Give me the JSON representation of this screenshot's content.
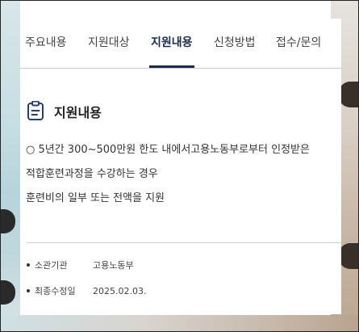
{
  "tabs": [
    {
      "label": "주요내용",
      "active": false
    },
    {
      "label": "지원대상",
      "active": false
    },
    {
      "label": "지원내용",
      "active": true
    },
    {
      "label": "신청방법",
      "active": false
    },
    {
      "label": "접수/문의",
      "active": false
    }
  ],
  "section": {
    "icon": "clipboard-icon",
    "title": "지원내용",
    "lines": [
      "○ 5년간 300~500만원 한도 내에서고용노동부로부터 인정받은",
      "적합훈련과정을 수강하는 경우",
      "훈련비의 일부 또는 전액을 지원"
    ]
  },
  "meta": {
    "agency_label": "소관기관",
    "agency_value": "고용노동부",
    "updated_label": "최종수정일",
    "updated_value": "2025.02.03."
  },
  "colors": {
    "accent": "#1b2b4e",
    "icon": "#2a3f6e"
  }
}
